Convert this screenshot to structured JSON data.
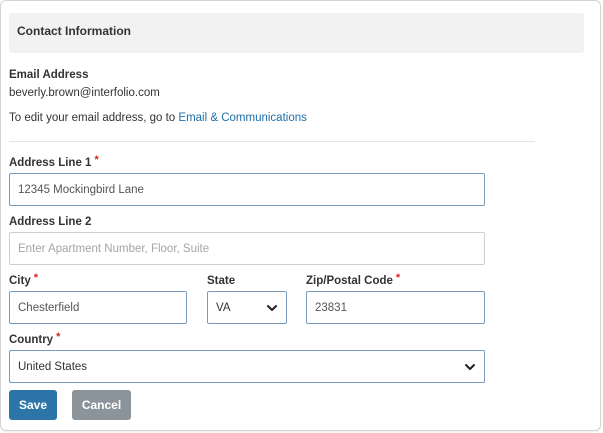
{
  "section": {
    "title": "Contact Information"
  },
  "email": {
    "label": "Email Address",
    "value": "beverly.brown@interfolio.com",
    "edit_note_prefix": "To edit your email address, go to ",
    "edit_link": "Email & Communications"
  },
  "fields": {
    "address1": {
      "label": "Address Line 1",
      "required_mark": "*",
      "value": "12345 Mockingbird Lane"
    },
    "address2": {
      "label": "Address Line 2",
      "placeholder": "Enter Apartment Number, Floor, Suite"
    },
    "city": {
      "label": "City",
      "required_mark": "*",
      "value": "Chesterfield"
    },
    "state": {
      "label": "State",
      "value": "VA"
    },
    "zip": {
      "label": "Zip/Postal Code",
      "required_mark": "*",
      "value": "23831"
    },
    "country": {
      "label": "Country",
      "required_mark": "*",
      "value": "United States"
    }
  },
  "actions": {
    "save_label": "Save",
    "cancel_label": "Cancel"
  },
  "colors": {
    "link": "#1e6fa8",
    "required": "#d9241c",
    "save_button": "#2d74a8",
    "cancel_button": "#8c949b",
    "header_bg": "#f2f2f2"
  },
  "icons": {
    "select_arrow": "chevron-down-icon"
  }
}
